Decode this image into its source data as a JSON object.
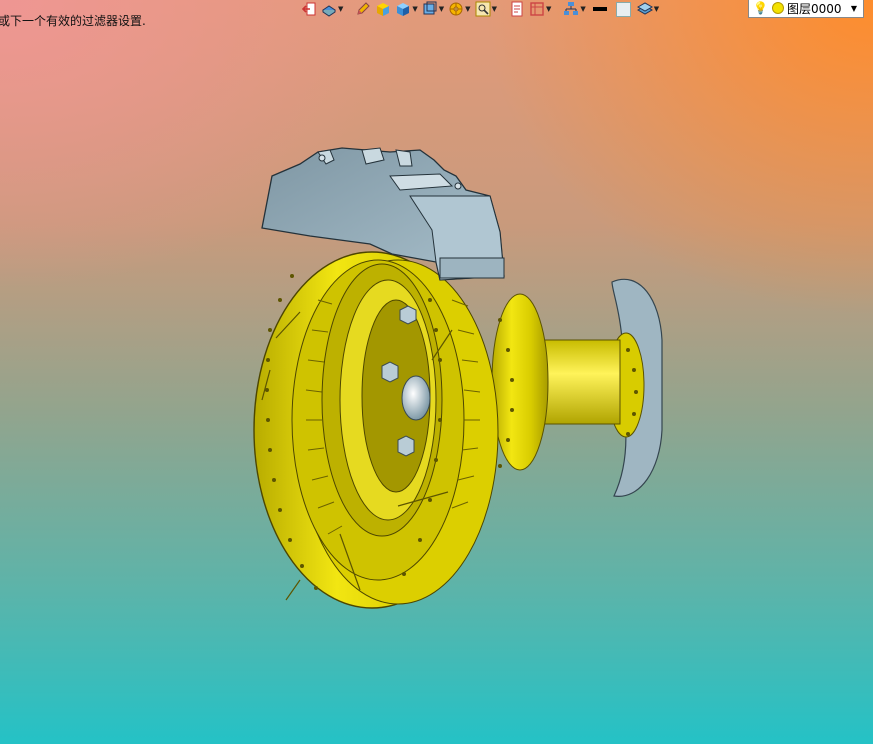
{
  "status": {
    "message": "或下一个有效的过滤器设置."
  },
  "toolbar": {
    "icons": [
      "exit-icon",
      "view-orient-icon",
      "pencil-icon",
      "shaded-box-icon",
      "cube-icon",
      "view-cube-icon",
      "wheel-icon",
      "zoom-fit-icon",
      "page-icon",
      "frame-icon",
      "tree-icon",
      "line-color-icon",
      "fill-color-icon",
      "layers-icon"
    ]
  },
  "layer": {
    "name": "图层0000"
  },
  "model": {
    "name": "brake-disc-assembly",
    "colors": {
      "disc": "#e0d400",
      "disc_dark": "#9c9100",
      "caliper": "#8fa6b2",
      "caliper_light": "#b9ccd6",
      "hub": "#eadc10"
    }
  }
}
